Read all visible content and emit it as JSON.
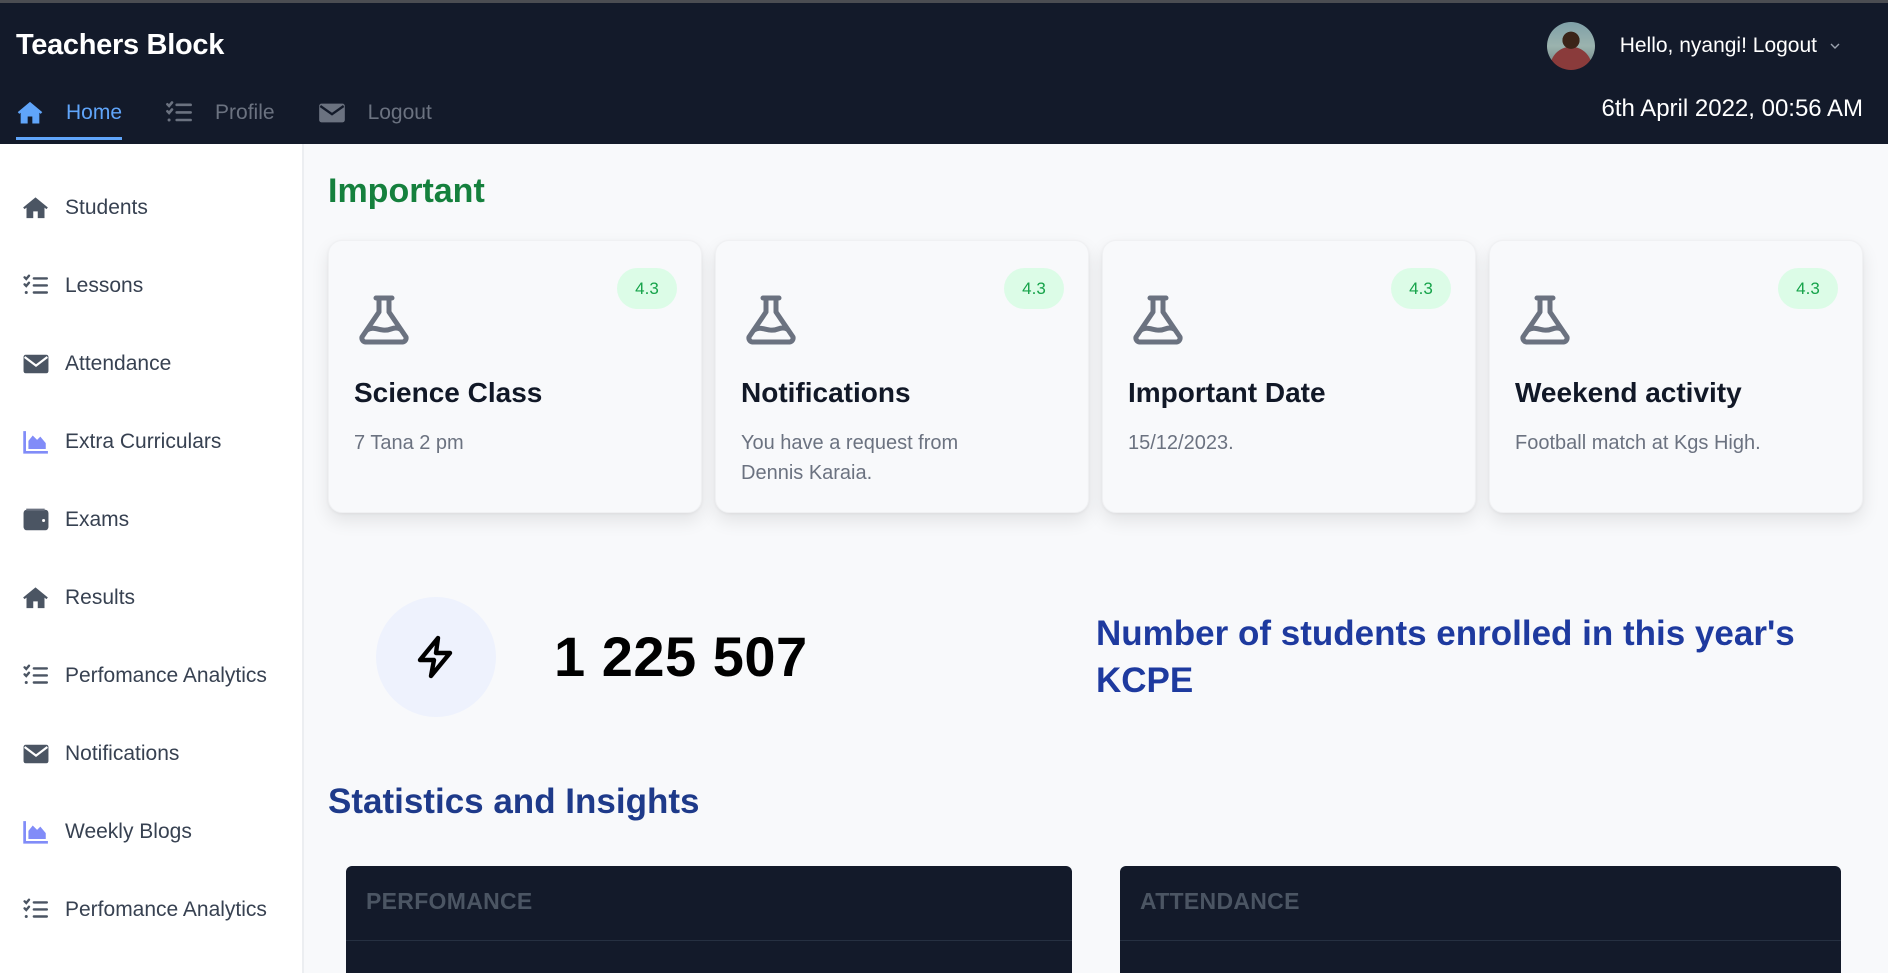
{
  "app": {
    "brand": "Teachers Block"
  },
  "navbar": {
    "tabs": [
      {
        "label": "Home",
        "icon": "home-icon",
        "active": true
      },
      {
        "label": "Profile",
        "icon": "list-check-icon",
        "active": false
      },
      {
        "label": "Logout",
        "icon": "envelope-icon",
        "active": false
      }
    ],
    "greeting": "Hello, nyangi! Logout",
    "datetime": "6th April 2022, 00:56 AM"
  },
  "sidebar": {
    "items": [
      {
        "label": "Students",
        "icon": "home-icon"
      },
      {
        "label": "Lessons",
        "icon": "list-check-icon"
      },
      {
        "label": "Attendance",
        "icon": "envelope-icon"
      },
      {
        "label": "Extra Curriculars",
        "icon": "chart-area-icon"
      },
      {
        "label": "Exams",
        "icon": "wallet-icon"
      },
      {
        "label": "Results",
        "icon": "home-icon"
      },
      {
        "label": "Perfomance Analytics",
        "icon": "list-check-icon"
      },
      {
        "label": "Notifications",
        "icon": "envelope-icon"
      },
      {
        "label": "Weekly Blogs",
        "icon": "chart-area-icon"
      },
      {
        "label": "Perfomance Analytics",
        "icon": "list-check-icon"
      }
    ]
  },
  "main": {
    "important_heading": "Important",
    "cards": [
      {
        "badge": "4.3",
        "title": "Science Class",
        "description": "7 Tana 2 pm"
      },
      {
        "badge": "4.3",
        "title": "Notifications",
        "description": "You have a request from Dennis Karaia."
      },
      {
        "badge": "4.3",
        "title": "Important Date",
        "description": "15/12/2023."
      },
      {
        "badge": "4.3",
        "title": "Weekend activity",
        "description": "Football match at Kgs High."
      }
    ],
    "stat": {
      "value": "1 225 507",
      "caption": "Number of students enrolled in this year's KCPE"
    },
    "stats_heading": "Statistics and Insights",
    "panels": [
      {
        "title": "PERFOMANCE"
      },
      {
        "title": "ATTENDANCE"
      }
    ]
  },
  "colors": {
    "navbar_bg": "#131a2a",
    "accent_blue": "#60a5fa",
    "important_green": "#15803d",
    "badge_bg": "#dcfce7",
    "badge_text": "#16a34a",
    "stats_heading": "#1e3a8a",
    "sidebar_chart_icon": "#818cf8"
  }
}
